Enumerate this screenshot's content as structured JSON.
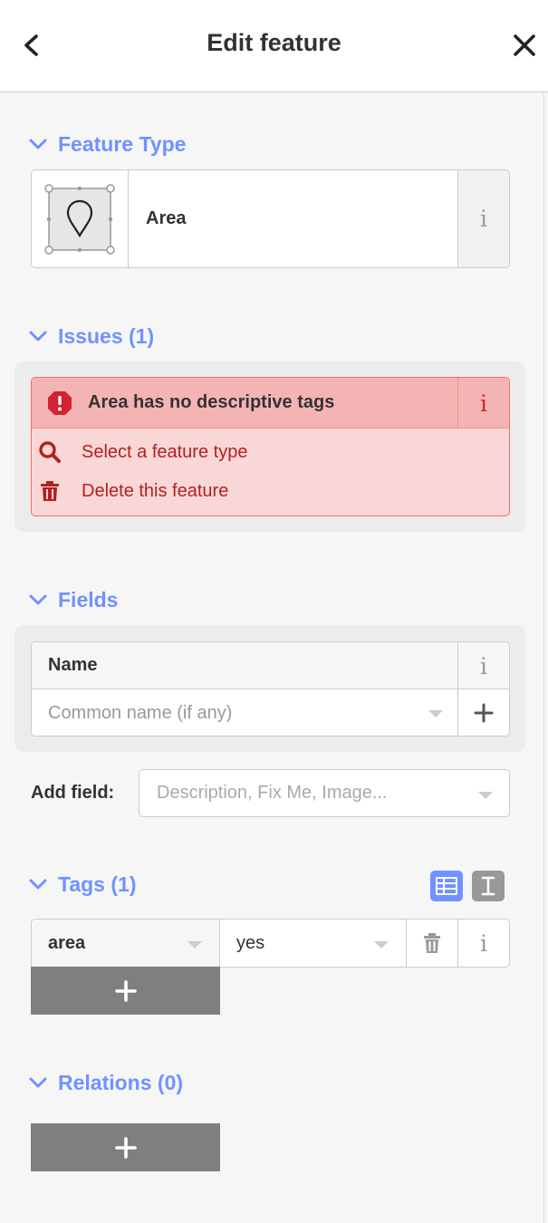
{
  "header": {
    "title": "Edit feature",
    "back_icon": "chevron-left-icon",
    "close_icon": "close-icon"
  },
  "feature_type": {
    "section_title": "Feature Type",
    "selected": "Area",
    "icon": "area-pin-icon"
  },
  "issues": {
    "section_title": "Issues (1)",
    "items": [
      {
        "message": "Area has no descriptive tags",
        "fixes": [
          {
            "label": "Select a feature type",
            "icon": "search-icon"
          },
          {
            "label": "Delete this feature",
            "icon": "trash-icon"
          }
        ]
      }
    ]
  },
  "fields": {
    "section_title": "Fields",
    "name_field": {
      "label": "Name",
      "placeholder": "Common name (if any)"
    },
    "add_field": {
      "label": "Add field:",
      "placeholder": "Description, Fix Me, Image..."
    }
  },
  "tags": {
    "section_title": "Tags (1)",
    "rows": [
      {
        "key": "area",
        "value": "yes"
      }
    ],
    "view_list_icon": "list-view-icon",
    "view_text_icon": "text-view-icon"
  },
  "relations": {
    "section_title": "Relations (0)"
  },
  "colors": {
    "accent": "#7092ff",
    "issue_bg": "#fad7d7",
    "issue_head": "#f5b4b4",
    "issue_text": "#b22020",
    "button_gray": "#7f7f7f"
  }
}
